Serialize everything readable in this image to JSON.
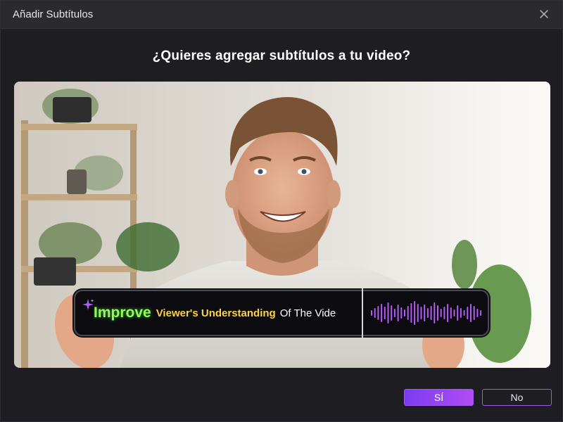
{
  "window": {
    "title": "Añadir Subtítulos",
    "close_icon": "close-icon"
  },
  "dialog": {
    "question": "¿Quieres agregar subtítulos a tu video?"
  },
  "preview": {
    "image": "man-smiling-in-room",
    "caption": {
      "sparkle_icon": "sparkle-icon",
      "word_highlight": "Improve",
      "phrase_highlight": "Viewer's Understanding",
      "phrase_rest": "Of The Vide",
      "colors": {
        "highlight": "#8cff57",
        "phrase": "#ffd43a",
        "rest": "#ffffff",
        "waveform": "#b15cf5"
      }
    }
  },
  "buttons": {
    "yes_label": "SÍ",
    "no_label": "No"
  },
  "colors": {
    "accent": "#8a44f2",
    "background": "#1e1e22",
    "titlebar": "#2a2a2f"
  }
}
